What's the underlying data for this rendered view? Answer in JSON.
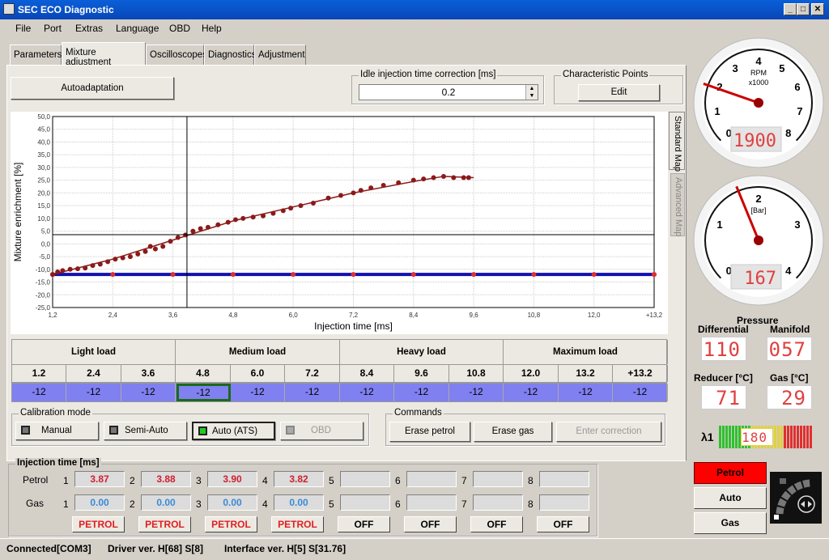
{
  "window": {
    "title": "SEC ECO Diagnostic",
    "controls": [
      "_",
      "□",
      "✕"
    ]
  },
  "menu": [
    "File",
    "Port",
    "Extras",
    "Language",
    "OBD",
    "Help"
  ],
  "tabs": [
    {
      "label": "Parameters"
    },
    {
      "label": "Mixture adjustment",
      "active": true
    },
    {
      "label": "Oscilloscopes"
    },
    {
      "label": "Diagnostics"
    },
    {
      "label": "Adjustment"
    }
  ],
  "top": {
    "autoadaptation": "Autoadaptation",
    "idle_label": "Idle injection time correction [ms]",
    "idle_value": "0.2",
    "char_label": "Characteristic Points",
    "edit": "Edit"
  },
  "side_tabs": {
    "standard": "Standard Map",
    "advanced": "Advanced Map"
  },
  "chart_data": {
    "type": "scatter",
    "xlabel": "Injection time [ms]",
    "ylabel": "Mixture enrichment [%]",
    "xlim": [
      1.2,
      13.2
    ],
    "ylim": [
      -25,
      50
    ],
    "xticks": [
      "1,2",
      "2,4",
      "3,6",
      "4,8",
      "6,0",
      "7,2",
      "8,4",
      "9,6",
      "10,8",
      "12,0",
      "13,2",
      "+13,2"
    ],
    "yticks": [
      "50,0",
      "45,0",
      "40,0",
      "35,0",
      "30,0",
      "25,0",
      "20,0",
      "15,0",
      "10,0",
      "5,0",
      "0,0",
      "-5,0",
      "-10,0",
      "-15,0",
      "-20,0",
      "-25,0"
    ],
    "grid": true,
    "cursor": {
      "x": 3.88,
      "y": 3.6
    },
    "measured_points": [
      [
        1.2,
        -12
      ],
      [
        1.3,
        -11
      ],
      [
        1.4,
        -10.5
      ],
      [
        1.55,
        -10
      ],
      [
        1.7,
        -9.8
      ],
      [
        1.85,
        -9.5
      ],
      [
        2.0,
        -8.5
      ],
      [
        2.15,
        -8
      ],
      [
        2.3,
        -7
      ],
      [
        2.45,
        -6
      ],
      [
        2.6,
        -5.5
      ],
      [
        2.75,
        -5
      ],
      [
        2.9,
        -4
      ],
      [
        3.05,
        -3
      ],
      [
        3.15,
        -1
      ],
      [
        3.25,
        -2
      ],
      [
        3.4,
        -1
      ],
      [
        3.55,
        1
      ],
      [
        3.7,
        2.5
      ],
      [
        3.85,
        3.5
      ],
      [
        4.0,
        5
      ],
      [
        4.15,
        6
      ],
      [
        4.3,
        6.5
      ],
      [
        4.5,
        7.5
      ],
      [
        4.7,
        8.5
      ],
      [
        4.85,
        9.5
      ],
      [
        5.0,
        10
      ],
      [
        5.2,
        10.5
      ],
      [
        5.4,
        11
      ],
      [
        5.6,
        12
      ],
      [
        5.8,
        13
      ],
      [
        5.95,
        14
      ],
      [
        6.15,
        15
      ],
      [
        6.4,
        16
      ],
      [
        6.7,
        18
      ],
      [
        6.95,
        19
      ],
      [
        7.2,
        20
      ],
      [
        7.35,
        21
      ],
      [
        7.55,
        22
      ],
      [
        7.8,
        23
      ],
      [
        8.1,
        24
      ],
      [
        8.4,
        25
      ],
      [
        8.6,
        25.5
      ],
      [
        8.8,
        26
      ],
      [
        9.0,
        26.5
      ],
      [
        9.2,
        26
      ],
      [
        9.4,
        26
      ],
      [
        9.5,
        26
      ]
    ],
    "fit_curve": [
      [
        1.2,
        -12
      ],
      [
        2.4,
        -6
      ],
      [
        3.6,
        1.5
      ],
      [
        4.8,
        9
      ],
      [
        6.0,
        14.5
      ],
      [
        7.2,
        20
      ],
      [
        8.4,
        24.5
      ],
      [
        9.0,
        26.5
      ],
      [
        9.6,
        26
      ]
    ],
    "map_series": {
      "x": [
        1.2,
        2.4,
        3.6,
        4.8,
        6.0,
        7.2,
        8.4,
        9.6,
        10.8,
        12.0,
        13.2,
        14.4
      ],
      "y": [
        -12,
        -12,
        -12,
        -12,
        -12,
        -12,
        -12,
        -12,
        -12,
        -12,
        -12,
        -12
      ]
    },
    "colors": {
      "measured": "#8b1a1a",
      "map_line": "#1010b0",
      "map_points": "#e03030"
    }
  },
  "load_groups": [
    "Light load",
    "Medium load",
    "Heavy load",
    "Maximum load"
  ],
  "map_table": {
    "headers": [
      "1.2",
      "2.4",
      "3.6",
      "4.8",
      "6.0",
      "7.2",
      "8.4",
      "9.6",
      "10.8",
      "12.0",
      "13.2",
      "+13.2"
    ],
    "values": [
      "-12",
      "-12",
      "-12",
      "-12",
      "-12",
      "-12",
      "-12",
      "-12",
      "-12",
      "-12",
      "-12",
      "-12"
    ],
    "selected_index": 3
  },
  "calibration": {
    "label": "Calibration mode",
    "modes": [
      {
        "label": "Manual",
        "active": false
      },
      {
        "label": "Semi-Auto",
        "active": false
      },
      {
        "label": "Auto (ATS)",
        "active": true
      },
      {
        "label": "OBD",
        "disabled": true
      }
    ]
  },
  "commands": {
    "label": "Commands",
    "erase_petrol": "Erase petrol",
    "erase_gas": "Erase gas",
    "enter_correction": "Enter correction"
  },
  "injection": {
    "label": "Injection time [ms]",
    "petrol_label": "Petrol",
    "gas_label": "Gas",
    "channels": [
      "1",
      "2",
      "3",
      "4",
      "5",
      "6",
      "7",
      "8"
    ],
    "petrol": [
      "3.87",
      "3.88",
      "3.90",
      "3.82",
      "",
      "",
      "",
      ""
    ],
    "gas": [
      "0.00",
      "0.00",
      "0.00",
      "0.00",
      "",
      "",
      "",
      ""
    ],
    "status": [
      "PETROL",
      "PETROL",
      "PETROL",
      "PETROL",
      "OFF",
      "OFF",
      "OFF",
      "OFF"
    ]
  },
  "statusbar": {
    "connected": "Connected[COM3]",
    "driver": "Driver ver. H[68] S[8]",
    "interface": "Interface ver. H[5] S[31.76]"
  },
  "rpm_gauge": {
    "label": "RPM",
    "unit": "x1000",
    "ticks": [
      "0",
      "1",
      "2",
      "3",
      "4",
      "5",
      "6",
      "7",
      "8"
    ],
    "value": 1900,
    "display": "1900"
  },
  "pressure_gauge": {
    "unit": "[Bar]",
    "ticks": [
      "0",
      "1",
      "2",
      "3",
      "4"
    ],
    "value": 1.67,
    "display": "167"
  },
  "readouts": {
    "pressure_title": "Pressure",
    "differential_label": "Differential",
    "differential": "110",
    "manifold_label": "Manifold",
    "manifold": "057",
    "reducer_label": "Reducer [°C]",
    "reducer": "71",
    "gas_label": "Gas [°C]",
    "gas": "29"
  },
  "lambda": {
    "label": "λ1",
    "value": "180"
  },
  "fuel_buttons": {
    "petrol": "Petrol",
    "auto": "Auto",
    "gas": "Gas",
    "active": "Petrol",
    "active_color": "#ff0000"
  }
}
